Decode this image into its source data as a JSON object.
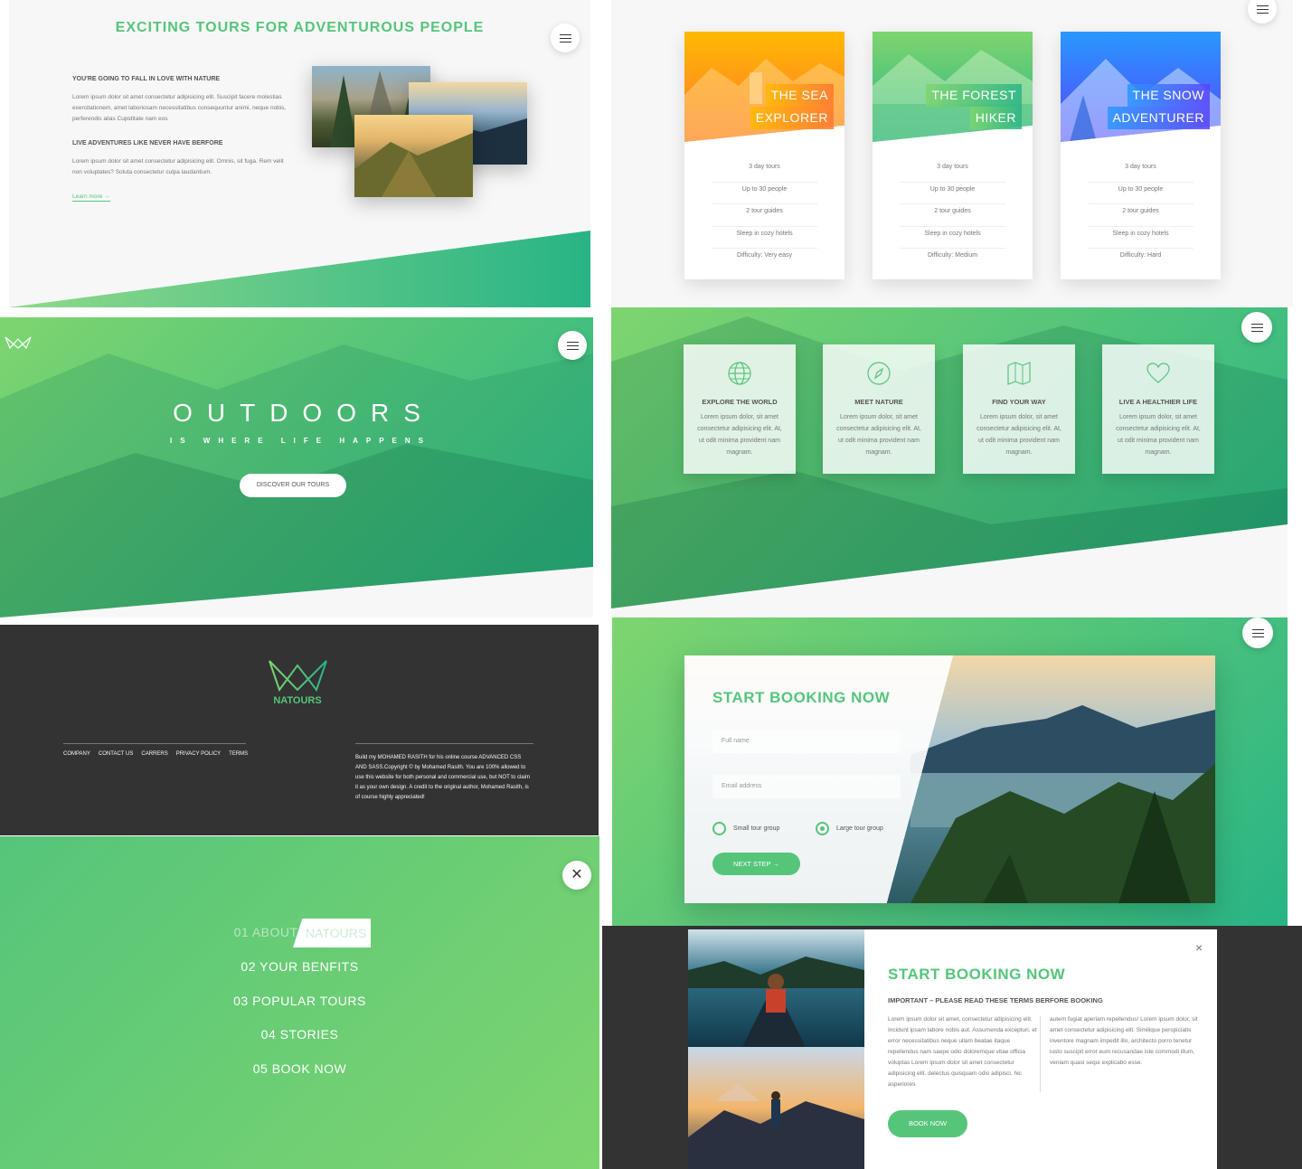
{
  "colors": {
    "primary": "#55c57a",
    "primary_light": "#7ed56f",
    "primary_dark": "#28b485",
    "dark": "#333333"
  },
  "about": {
    "title": "EXCITING TOURS FOR ADVENTUROUS PEOPLE",
    "h1": "YOU'RE GOING TO FALL IN LOVE WITH NATURE",
    "p1": "Lorem ipsum dolor sit amet consectetur adipisicing elit. Suscipit facere molestias exercitationem, amet laboriosam necessitatibus consequuntur animi, neque nobis, perferendis alias Cupiditate nam eos",
    "h2": "LIVE ADVENTURES LIKE NEVER HAVE BERFORE",
    "p2": "Lorem ipsum dolor sit amet consectetur adipisicing elit. Omnis, sit fuga. Rem velit non voluptates? Soluta consectetur culpa laudantium.",
    "learn_more": "Learn more →"
  },
  "tours": [
    {
      "title_1": "THE SEA",
      "title_2": "EXPLORER",
      "days": "3 day tours",
      "people": "Up to 30 people",
      "guides": "2 tour guides",
      "sleep": "Sleep in cozy hotels",
      "difficulty": "Difficulty: Very easy"
    },
    {
      "title_1": "THE FOREST",
      "title_2": "HIKER",
      "days": "3 day tours",
      "people": "Up to 30 people",
      "guides": "2 tour guides",
      "sleep": "Sleep in cozy hotels",
      "difficulty": "Difficulty: Medium"
    },
    {
      "title_1": "THE SNOW",
      "title_2": "ADVENTURER",
      "days": "3 day tours",
      "people": "Up to 30 people",
      "guides": "2 tour guides",
      "sleep": "Sleep in cozy hotels",
      "difficulty": "Difficulty: Hard"
    }
  ],
  "hero": {
    "title_main": "OUTDOORS",
    "title_sub": "IS WHERE LIFE HAPPENS",
    "cta": "DISCOVER OUR TOURS"
  },
  "features": [
    {
      "icon": "globe-icon",
      "title": "EXPLORE THE WORLD",
      "text": "Lorem ipsum dolor, sit amet consectetur adipisicing elit. At, ut odit minima provident nam magnam."
    },
    {
      "icon": "compass-icon",
      "title": "MEET NATURE",
      "text": "Lorem ipsum dolor, sit amet consectetur adipisicing elit. At, ut odit minima provident nam magnam."
    },
    {
      "icon": "map-icon",
      "title": "FIND YOUR WAY",
      "text": "Lorem ipsum dolor, sit amet consectetur adipisicing elit. At, ut odit minima provident nam magnam."
    },
    {
      "icon": "heart-icon",
      "title": "LIVE A HEALTHIER LIFE",
      "text": "Lorem ipsum dolor, sit amet consectetur adipisicing elit. At, ut odit minima provident nam magnam."
    }
  ],
  "footer": {
    "logo": "NATOURS",
    "nav": [
      "COMPANY",
      "CONTACT US",
      "CARRERS",
      "PRIVACY POLICY",
      "TERMS"
    ],
    "copyright": "Build my MOHAMED RASITH for his online course ADVANCED CSS AND SASS.Copyright © by Mohamed Rasith. You are 100% allowed to use this website for both personal and commercial use, but NOT to claim it as your own design. A credit to the original author, Mohamed Rasith, is of course highly appreciated!"
  },
  "booking": {
    "title": "START BOOKING NOW",
    "name_placeholder": "Full name",
    "email_placeholder": "Email address",
    "small": "Small tour group",
    "large": "Large tour group",
    "next": "NEXT STEP →"
  },
  "navigation": {
    "items": [
      "01  ABOUT NATOURS",
      "02  YOUR BENFITS",
      "03  POPULAR TOURS",
      "04  STORIES",
      "05  BOOK NOW"
    ],
    "highlight": "NATOURS"
  },
  "popup": {
    "title": "START BOOKING NOW",
    "subtitle": "IMPORTANT – PLEASE READ THESE TERMS BERFORE BOOKING",
    "col1": "Lorem ipsum dolor sit amet, consectetur adipisicing elit. Incidunt ipsam labore nobis aut. Assumenda excepturi, et error necessitatibus neque ullam beatae itaque repellendus nam saepe odio doloremque vitae officia voluptas Lorem ipsum dolor sit amet consectetur adipisicing elit. delectus quisquam odio adipisci, hic asperiores",
    "col2": "autem fugiat aperiam repellendus! Lorem ipsum dolor, sit amet consectetur adipisicing elit. Similique perspiciatis inventore magnam impedit illo, architecto porro tenetur iusto suscipit error eum recusandae iste commodi illum, veniam quasi sequi explicabo esse.",
    "book": "BOOK NOW",
    "close": "×"
  }
}
